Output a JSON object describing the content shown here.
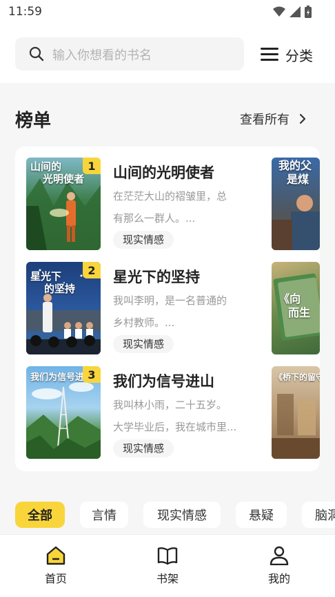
{
  "status_bar": {
    "time": "11:59"
  },
  "search": {
    "placeholder": "输入你想看的书名"
  },
  "category": {
    "label": "分类"
  },
  "ranking": {
    "title": "榜单",
    "view_all": "查看所有",
    "items": [
      {
        "rank": "1",
        "title": "山间的光明使者",
        "cover_title_line1": "山间的",
        "cover_title_line2": "光明使者",
        "desc_line1": "在茫茫大山的褶皱里，总",
        "desc_line2": "有那么一群人。...",
        "tag": "现实情感"
      },
      {
        "rank": "2",
        "title": "星光下的坚持",
        "cover_title_line1": "星光下",
        "cover_title_line2": "的坚持",
        "desc_line1": "我叫李明，是一名普通的",
        "desc_line2": "乡村教师。...",
        "tag": "现实情感"
      },
      {
        "rank": "3",
        "title": "我们为信号进山",
        "cover_title_line1": "我们为信号进山",
        "cover_title_line2": "",
        "desc_line1": "我叫林小雨，二十五岁。",
        "desc_line2": "大学毕业后，我在城市里...",
        "tag": "现实情感"
      }
    ],
    "side_covers": [
      {
        "title_line1": "我的父",
        "title_line2": "是煤"
      },
      {
        "title_line1": "《向",
        "title_line2": "而生"
      },
      {
        "title_line1": "《桥下的留守",
        "title_line2": ""
      }
    ]
  },
  "filters": [
    "全部",
    "言情",
    "现实情感",
    "悬疑",
    "脑洞"
  ],
  "bottom_nav": [
    {
      "label": "首页",
      "icon": "home-icon"
    },
    {
      "label": "书架",
      "icon": "book-icon"
    },
    {
      "label": "我的",
      "icon": "user-icon"
    }
  ],
  "colors": {
    "accent": "#f8d53a",
    "background": "#f6f6f6"
  }
}
